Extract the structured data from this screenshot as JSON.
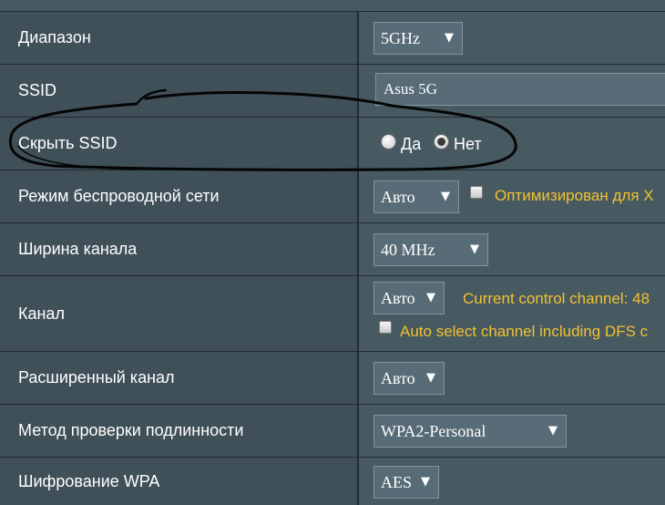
{
  "rows": {
    "band": {
      "label": "Диапазон",
      "value": "5GHz"
    },
    "ssid": {
      "label": "SSID",
      "value": "Asus 5G"
    },
    "hide_ssid": {
      "label": "Скрыть SSID",
      "option_yes": "Да",
      "option_no": "Нет",
      "selected": "Нет"
    },
    "wireless_mode": {
      "label": "Режим беспроводной сети",
      "value": "Авто",
      "checkbox_label": "Оптимизирован для X",
      "checked": false
    },
    "channel_width": {
      "label": "Ширина канала",
      "value": "40 MHz"
    },
    "channel": {
      "label": "Канал",
      "value": "Авто",
      "info": "Current control channel: 48",
      "checkbox_label": "Auto select channel including DFS c",
      "checked": false
    },
    "extension_channel": {
      "label": "Расширенный канал",
      "value": "Авто"
    },
    "auth_method": {
      "label": "Метод проверки подлинности",
      "value": "WPA2-Personal"
    },
    "wpa_encryption": {
      "label": "Шифрование WPA",
      "value": "AES"
    }
  },
  "icons": {
    "dropdown_arrow": "▼"
  },
  "colors": {
    "label_bg": "#3f5058",
    "value_bg": "#475961",
    "hint_text": "#f1c232",
    "border": "#222b2f"
  }
}
